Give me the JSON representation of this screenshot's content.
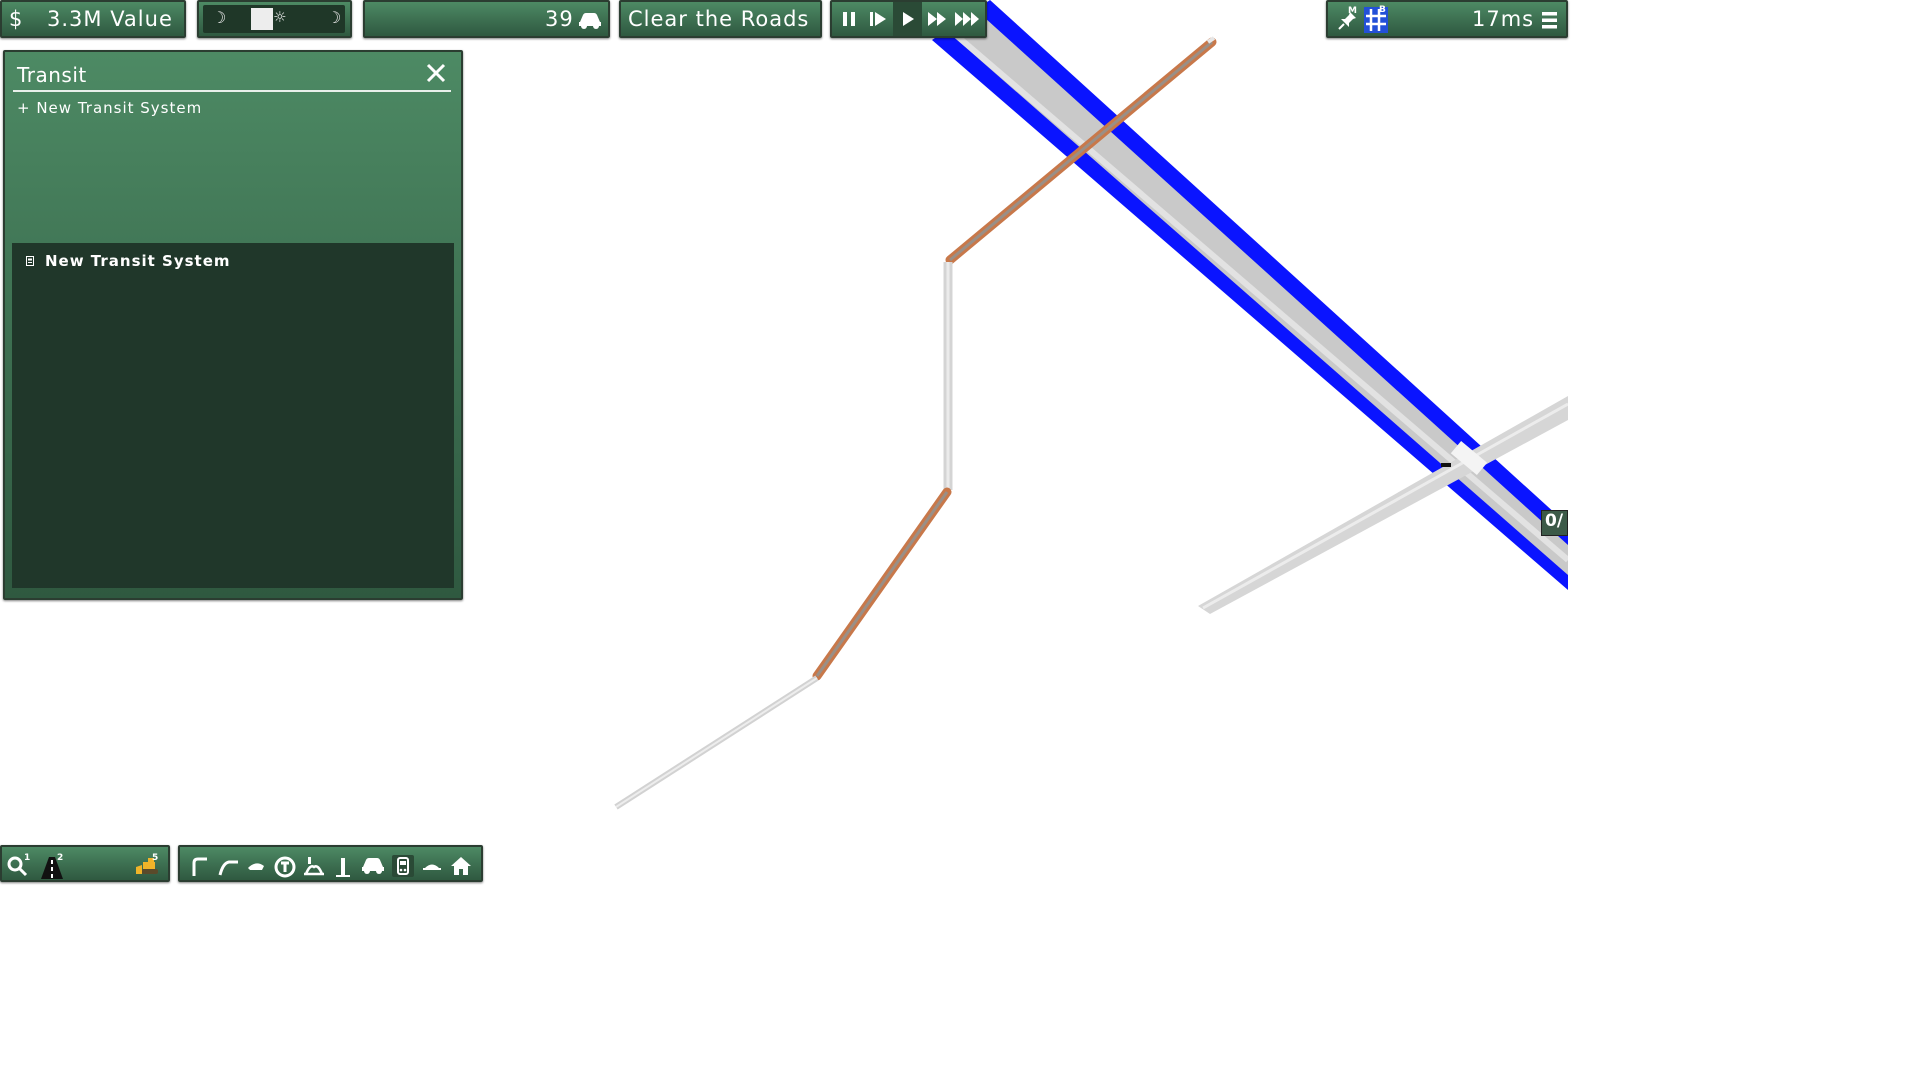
{
  "topbar": {
    "money_symbol": "$",
    "value_text": "3.3M Value",
    "vehicles_count": "39",
    "objective": "Clear the Roads",
    "frame_time": "17ms",
    "tool_m_label": "M",
    "tool_b_label": "B"
  },
  "transit_window": {
    "title": "Transit",
    "new_button_label": "+ New Transit System",
    "systems": [
      {
        "name": "New Transit System"
      }
    ]
  },
  "map_overlay": {
    "counter_text": "0/"
  },
  "bottom_left_toolbar": {
    "query_badge": "1",
    "road_badge": "2",
    "bulldoze_badge": "5"
  },
  "colors": {
    "panel_green": "#3c6e50",
    "panel_dark": "#20372a",
    "expressway_blue": "#0a14ff",
    "road_gray": "#d0d0d0",
    "elevated_orange": "#c8784a"
  }
}
